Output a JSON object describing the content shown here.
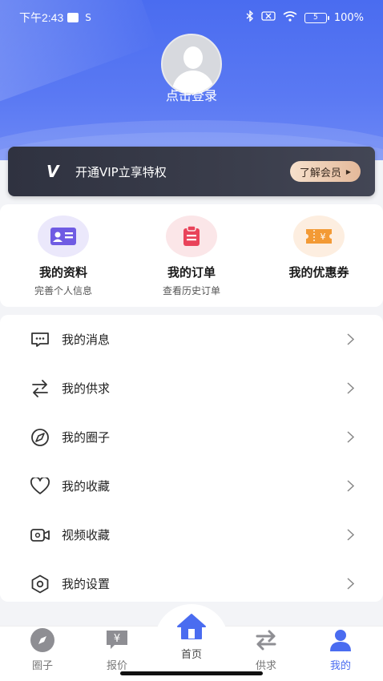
{
  "status_bar": {
    "time": "下午2:43",
    "s_icon": "S",
    "battery": "100%",
    "battery_short": "5"
  },
  "profile": {
    "login_text": "点击登录"
  },
  "vip": {
    "logo": "V",
    "text": "开通VIP立享特权",
    "button_label": "了解会员"
  },
  "quick_actions": [
    {
      "title": "我的资料",
      "subtitle": "完善个人信息",
      "icon": "id-card-icon",
      "color": "#6f5be3",
      "bg": "#ebe8fb"
    },
    {
      "title": "我的订单",
      "subtitle": "查看历史订单",
      "icon": "clipboard-icon",
      "color": "#e9435a",
      "bg": "#fbe6e8"
    },
    {
      "title": "我的优惠券",
      "subtitle": "",
      "icon": "coupon-icon",
      "color": "#f39a35",
      "bg": "#fdeee0"
    }
  ],
  "menu": [
    {
      "label": "我的消息",
      "icon": "message-icon"
    },
    {
      "label": "我的供求",
      "icon": "exchange-icon"
    },
    {
      "label": "我的圈子",
      "icon": "compass-icon"
    },
    {
      "label": "我的收藏",
      "icon": "heart-icon"
    },
    {
      "label": "视频收藏",
      "icon": "video-icon"
    },
    {
      "label": "我的设置",
      "icon": "settings-icon"
    }
  ],
  "nav": [
    {
      "label": "圈子",
      "icon": "compass-icon",
      "active": false
    },
    {
      "label": "报价",
      "icon": "yen-icon",
      "active": false
    },
    {
      "label": "首页",
      "icon": "home-icon",
      "active": false
    },
    {
      "label": "供求",
      "icon": "exchange-icon",
      "active": false
    },
    {
      "label": "我的",
      "icon": "user-icon",
      "active": true
    }
  ],
  "colors": {
    "accent": "#4a6cf0",
    "vip_bg": "#343744",
    "vip_button": "#f0d1b8"
  }
}
